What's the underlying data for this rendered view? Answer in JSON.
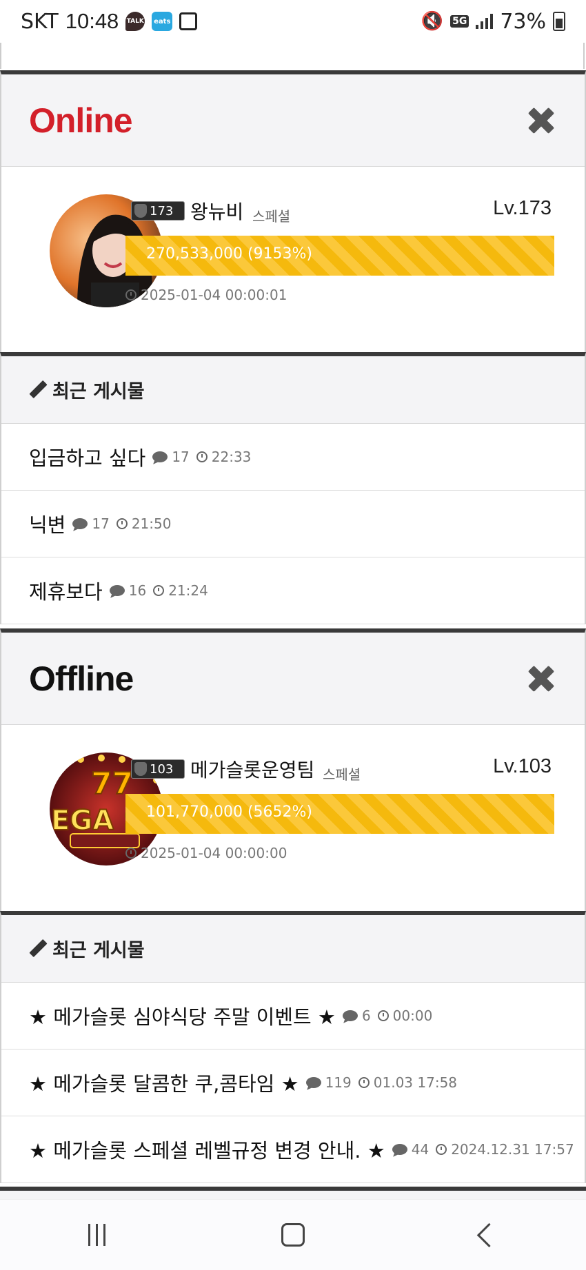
{
  "status_bar": {
    "carrier": "SKT",
    "time": "10:48",
    "notif_talk": "TALK",
    "notif_eats": "eats",
    "network": "5G",
    "battery": "73%"
  },
  "online": {
    "title": "Online",
    "profile": {
      "badge_level": "173",
      "nickname": "왕뉴비",
      "rank": "스페셜",
      "level": "Lv.173",
      "exp": "270,533,000 (9153%)",
      "date": "2025-01-04 00:00:01"
    },
    "recent": {
      "title": "최근 게시물",
      "posts": [
        {
          "title": "입금하고 싶다",
          "comments": "17",
          "time": "22:33"
        },
        {
          "title": "닉변",
          "comments": "17",
          "time": "21:50"
        },
        {
          "title": "제휴보다",
          "comments": "16",
          "time": "21:24"
        }
      ]
    }
  },
  "offline": {
    "title": "Offline",
    "profile": {
      "badge_level": "103",
      "nickname": "메가슬롯운영팀",
      "rank": "스페셜",
      "level": "Lv.103",
      "exp": "101,770,000 (5652%)",
      "date": "2025-01-04 00:00:00"
    },
    "recent": {
      "title": "최근 게시물",
      "posts": [
        {
          "title": "★ 메가슬롯 심야식당 주말 이벤트 ★",
          "comments": "6",
          "time": "00:00"
        },
        {
          "title": "★ 메가슬롯 달콤한 쿠,콤타임 ★",
          "comments": "119",
          "time": "01.03 17:58"
        },
        {
          "title": "★ 메가슬롯 스페셜 레벨규정 변경 안내. ★",
          "comments": "44",
          "time": "2024.12.31 17:57"
        }
      ]
    }
  }
}
